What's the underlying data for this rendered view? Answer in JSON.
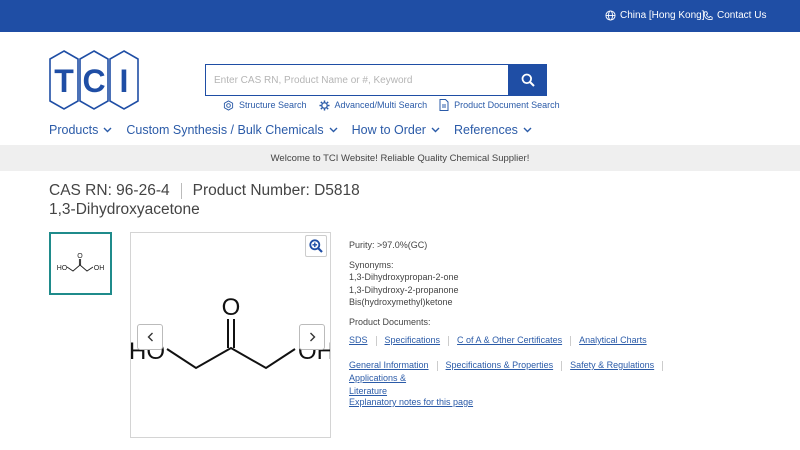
{
  "topbar": {
    "region": "China [Hong Kong]",
    "contact": "Contact Us",
    "bg_color": "#1f4ea5"
  },
  "logo": {
    "text": "TCI",
    "color": "#1f4ea5"
  },
  "search": {
    "placeholder": "Enter CAS RN, Product Name or #, Keyword",
    "links": [
      {
        "label": "Structure Search",
        "icon": "structure-search-icon"
      },
      {
        "label": "Advanced/Multi Search",
        "icon": "gear-icon"
      },
      {
        "label": "Product Document Search",
        "icon": "document-icon"
      }
    ]
  },
  "nav": [
    {
      "label": "Products"
    },
    {
      "label": "Custom Synthesis / Bulk Chemicals"
    },
    {
      "label": "How to Order"
    },
    {
      "label": "References"
    }
  ],
  "banner": "Welcome to TCI Website! Reliable Quality Chemical Supplier!",
  "product": {
    "cas": "CAS RN: 96-26-4",
    "number": "Product Number: D5818",
    "name": "1,3-Dihydroxyacetone",
    "purity": "Purity: >97.0%(GC)",
    "synonyms_label": "Synonyms:",
    "synonyms": [
      "1,3-Dihydroxypropan-2-one",
      "1,3-Dihydroxy-2-propanone",
      "Bis(hydroxymethyl)ketone"
    ],
    "docs_label": "Product Documents:",
    "doc_links": [
      "SDS",
      "Specifications",
      "C of A & Other Certificates",
      "Analytical Charts"
    ],
    "info_links": [
      "General Information",
      "Specifications & Properties",
      "Safety & Regulations",
      "Applications & Literature"
    ],
    "explanatory": "Explanatory notes for this page"
  },
  "structure": {
    "thumb_labels": [
      "HO",
      "O",
      "OH"
    ],
    "main_labels": [
      "HO",
      "O",
      "OH"
    ]
  },
  "colors": {
    "link": "#2b5ba8",
    "thumb_border": "#1f8b8b"
  }
}
